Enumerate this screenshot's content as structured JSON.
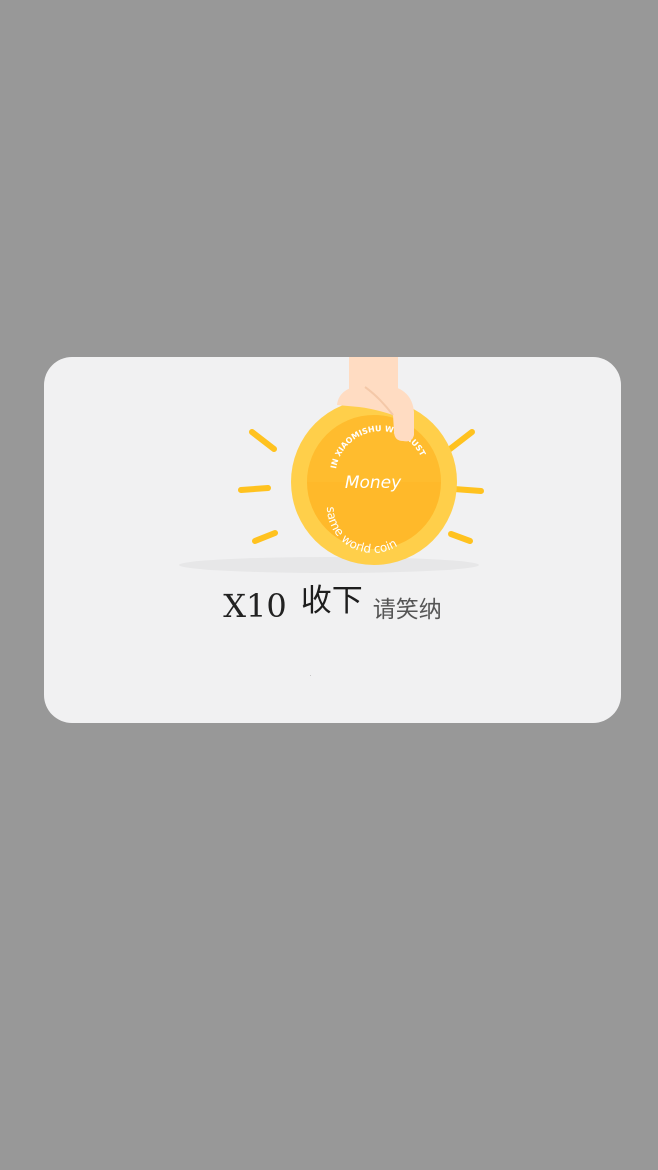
{
  "modal": {
    "coin_top_text": "IN XIAOMISHU WE TRUST",
    "coin_center_text": "Money",
    "coin_bottom_text": "same world coin",
    "quantity": "X10",
    "accept_label": "收下",
    "polite_label": "请笑纳"
  },
  "colors": {
    "overlay": "#989898",
    "card": "#f1f1f2",
    "coin_outer": "#ffcf4a",
    "coin_inner": "#ffb92a",
    "ray": "#ffc21f",
    "hand": "#ffdcc2"
  }
}
